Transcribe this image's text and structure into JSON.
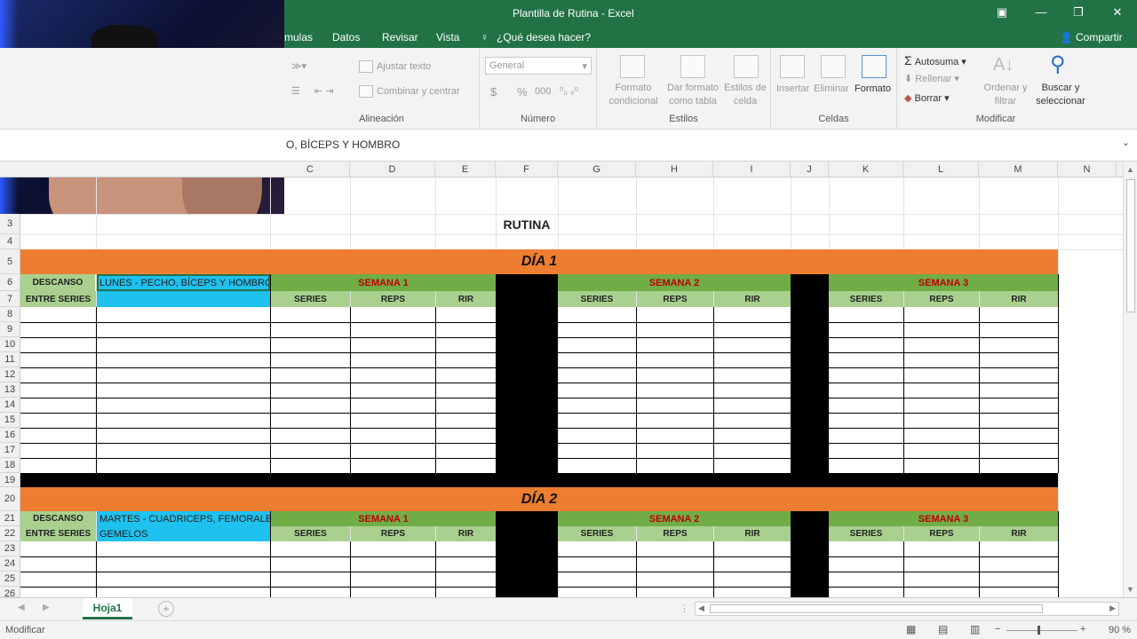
{
  "window": {
    "title": "Plantilla de Rutina - Excel",
    "share_label": "Compartir"
  },
  "ribbon_tabs": [
    "mulas",
    "Datos",
    "Revisar",
    "Vista"
  ],
  "tell_me": "¿Qué desea hacer?",
  "ribbon": {
    "alineacion": {
      "wrap_text": "Ajustar texto",
      "merge": "Combinar y centrar",
      "label": "Alineación"
    },
    "numero": {
      "format_value": "General",
      "currency": "$",
      "percent": "%",
      "thousands": "000",
      "label": "Número"
    },
    "estilos": {
      "cond_format": "Formato condicional",
      "as_table": "Dar formato como tabla",
      "cell_styles": "Estilos de celda",
      "label": "Estilos"
    },
    "celdas": {
      "insert": "Insertar",
      "delete": "Eliminar",
      "format": "Formato",
      "label": "Celdas"
    },
    "modificar": {
      "autosum": "Autosuma",
      "fill": "Rellenar",
      "clear": "Borrar",
      "sort": "Ordenar y filtrar",
      "find": "Buscar y seleccionar",
      "label": "Modificar"
    }
  },
  "formula_bar": {
    "content": "O, BÍCEPS Y HOMBRO"
  },
  "columns": [
    "C",
    "D",
    "E",
    "F",
    "G",
    "H",
    "I",
    "J",
    "K",
    "L",
    "M",
    "N"
  ],
  "rows": [
    "3",
    "4",
    "5",
    "6",
    "7",
    "8",
    "9",
    "10",
    "11",
    "12",
    "13",
    "14",
    "15",
    "16",
    "17",
    "18",
    "19",
    "20",
    "21",
    "22",
    "23",
    "24",
    "25",
    "26"
  ],
  "sheet": {
    "title": "RUTINA",
    "day1": {
      "header": "DÍA 1",
      "rest_top": "DESCANSO",
      "rest_bottom": "ENTRE SERIES",
      "routine": "LUNES - PECHO, BÍCEPS Y HOMBRO",
      "week1": "SEMANA 1",
      "week2": "SEMANA 2",
      "week3": "SEMANA 3",
      "sub": [
        "SERIES",
        "REPS",
        "RIR"
      ]
    },
    "day2": {
      "header": "DÍA 2",
      "rest_top": "DESCANSO",
      "rest_bottom": "ENTRE SERIES",
      "routine_line1": "MARTES - CUADRICEPS, FEMORALES",
      "routine_line2": "GEMELOS",
      "week1": "SEMANA 1",
      "week2": "SEMANA 2",
      "week3": "SEMANA 3",
      "sub": [
        "SERIES",
        "REPS",
        "RIR"
      ]
    }
  },
  "sheet_tabs": [
    "Hoja1"
  ],
  "status": {
    "mode": "Modificar",
    "zoom": "90 %"
  }
}
